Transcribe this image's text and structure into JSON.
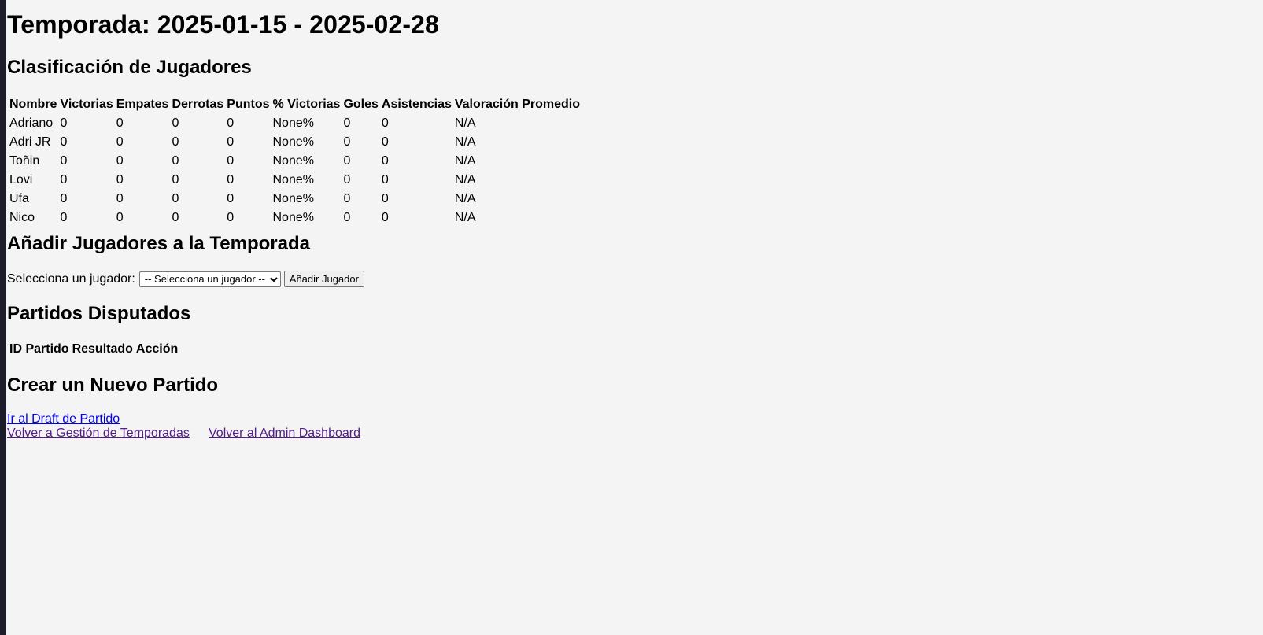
{
  "page": {
    "title": "Temporada: 2025-01-15 - 2025-02-28"
  },
  "standings": {
    "heading": "Clasificación de Jugadores",
    "columns": [
      "Nombre",
      "Victorias",
      "Empates",
      "Derrotas",
      "Puntos",
      "% Victorias",
      "Goles",
      "Asistencias",
      "Valoración Promedio"
    ],
    "rows": [
      [
        "Adriano",
        "0",
        "0",
        "0",
        "0",
        "None%",
        "0",
        "0",
        "N/A"
      ],
      [
        "Adri JR",
        "0",
        "0",
        "0",
        "0",
        "None%",
        "0",
        "0",
        "N/A"
      ],
      [
        "Toñin",
        "0",
        "0",
        "0",
        "0",
        "None%",
        "0",
        "0",
        "N/A"
      ],
      [
        "Lovi",
        "0",
        "0",
        "0",
        "0",
        "None%",
        "0",
        "0",
        "N/A"
      ],
      [
        "Ufa",
        "0",
        "0",
        "0",
        "0",
        "None%",
        "0",
        "0",
        "N/A"
      ],
      [
        "Nico",
        "0",
        "0",
        "0",
        "0",
        "None%",
        "0",
        "0",
        "N/A"
      ]
    ]
  },
  "add_players": {
    "heading": "Añadir Jugadores a la Temporada",
    "label": "Selecciona un jugador:",
    "select_value": "-- Selecciona un jugador --",
    "button_label": "Añadir Jugador"
  },
  "matches": {
    "heading": "Partidos Disputados",
    "columns": [
      "ID Partido",
      "Resultado",
      "Acción"
    ]
  },
  "create_match": {
    "heading": "Crear un Nuevo Partido",
    "draft_link": "Ir al Draft de Partido"
  },
  "footer_links": {
    "seasons": "Volver a Gestión de Temporadas",
    "dashboard": "Volver al Admin Dashboard"
  },
  "colors": {
    "background": "#f4f4f4",
    "link": "#0000ee",
    "visited_link": "#551a8b"
  }
}
